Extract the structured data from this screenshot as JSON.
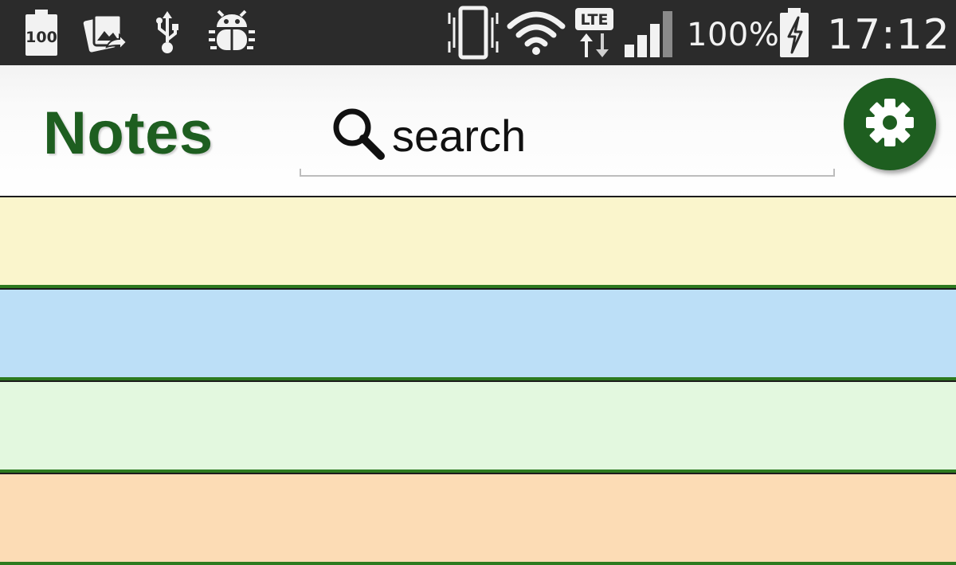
{
  "status_bar": {
    "notification_icons": [
      "battery-saver-100-icon",
      "gallery-share-icon",
      "usb-icon",
      "debug-bug-icon"
    ],
    "system_icons": [
      "vibrate-icon",
      "wifi-icon",
      "lte-icon",
      "signal-icon",
      "charging-battery-icon"
    ],
    "lte_label": "LTE",
    "battery_saver_label": "100",
    "battery_percent": "100%",
    "time": "17:12"
  },
  "app_bar": {
    "title": "Notes",
    "search": {
      "placeholder": "search",
      "value": ""
    },
    "settings_icon": "gear-icon"
  },
  "notes": [
    {
      "color": "#faf5cc"
    },
    {
      "color": "#bcdff7"
    },
    {
      "color": "#e3f8df"
    },
    {
      "color": "#fcdcb5"
    }
  ],
  "colors": {
    "status_bar": "#2b2b2b",
    "brand_green": "#1e5e20",
    "divider_green": "#2d7a1f"
  }
}
